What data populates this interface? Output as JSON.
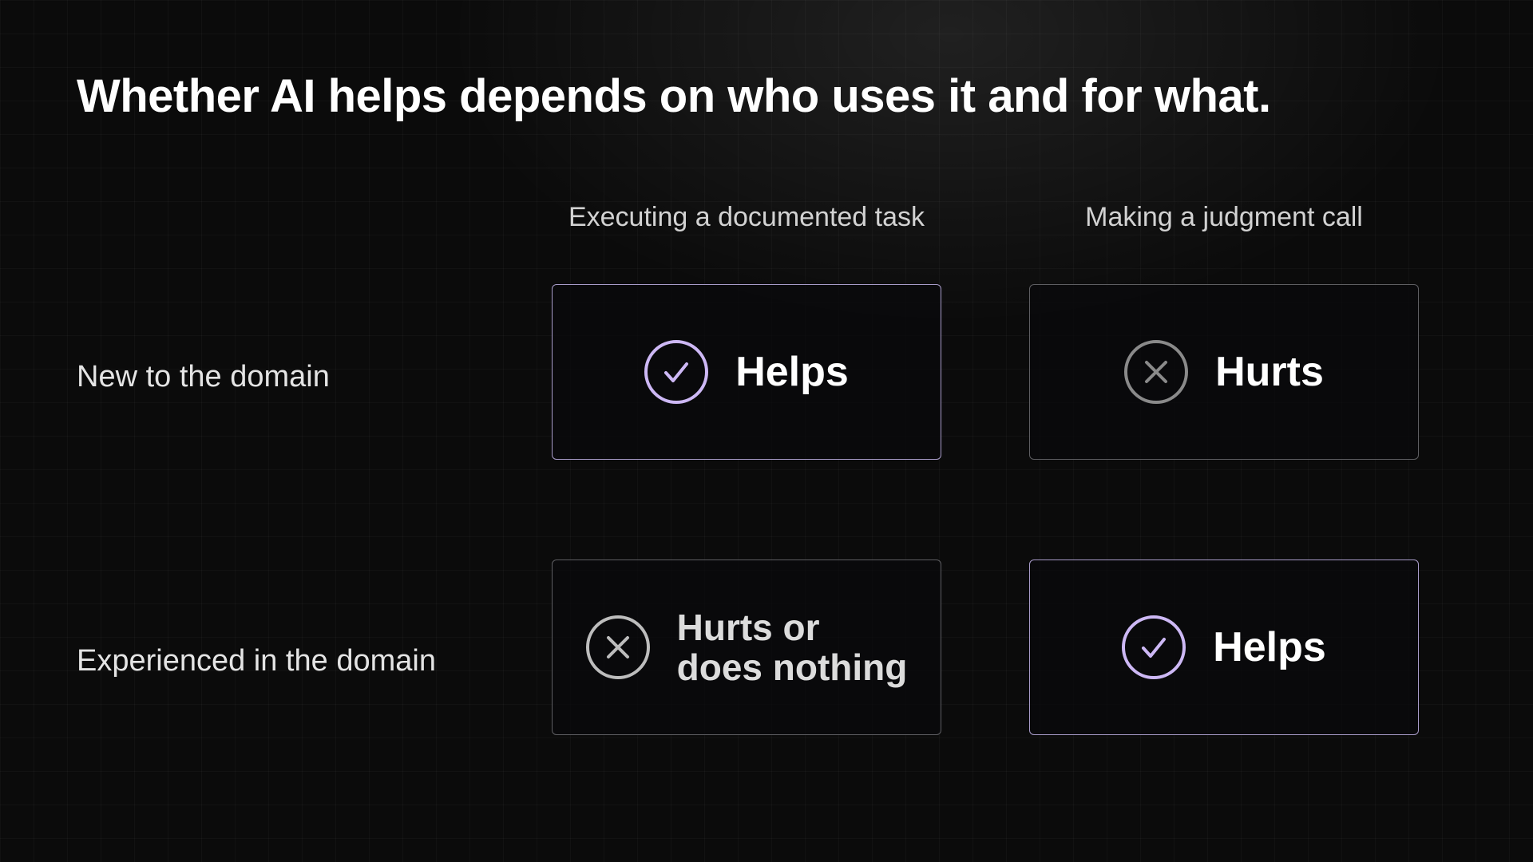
{
  "title": "Whether AI helps depends on who uses it and for what.",
  "columns": [
    {
      "label": "Executing a documented task"
    },
    {
      "label": "Making a judgment call"
    }
  ],
  "rows": [
    {
      "label": "New to the domain",
      "cells": [
        {
          "outcome": "Helps",
          "icon": "check-circle-icon",
          "color": "#cdb8f5"
        },
        {
          "outcome": "Hurts",
          "icon": "x-circle-icon",
          "color": "#8a8a8a"
        }
      ]
    },
    {
      "label": "Experienced in the domain",
      "cells": [
        {
          "outcome": "Hurts or\ndoes nothing",
          "icon": "x-circle-icon",
          "color": "#bdbdbd"
        },
        {
          "outcome": "Helps",
          "icon": "check-circle-icon",
          "color": "#cdb8f5"
        }
      ]
    }
  ],
  "colors": {
    "background": "#0b0b0b",
    "accent": "#cdb8f5",
    "good_border": "#a89cc9",
    "bad_border": "#5e5e62"
  }
}
